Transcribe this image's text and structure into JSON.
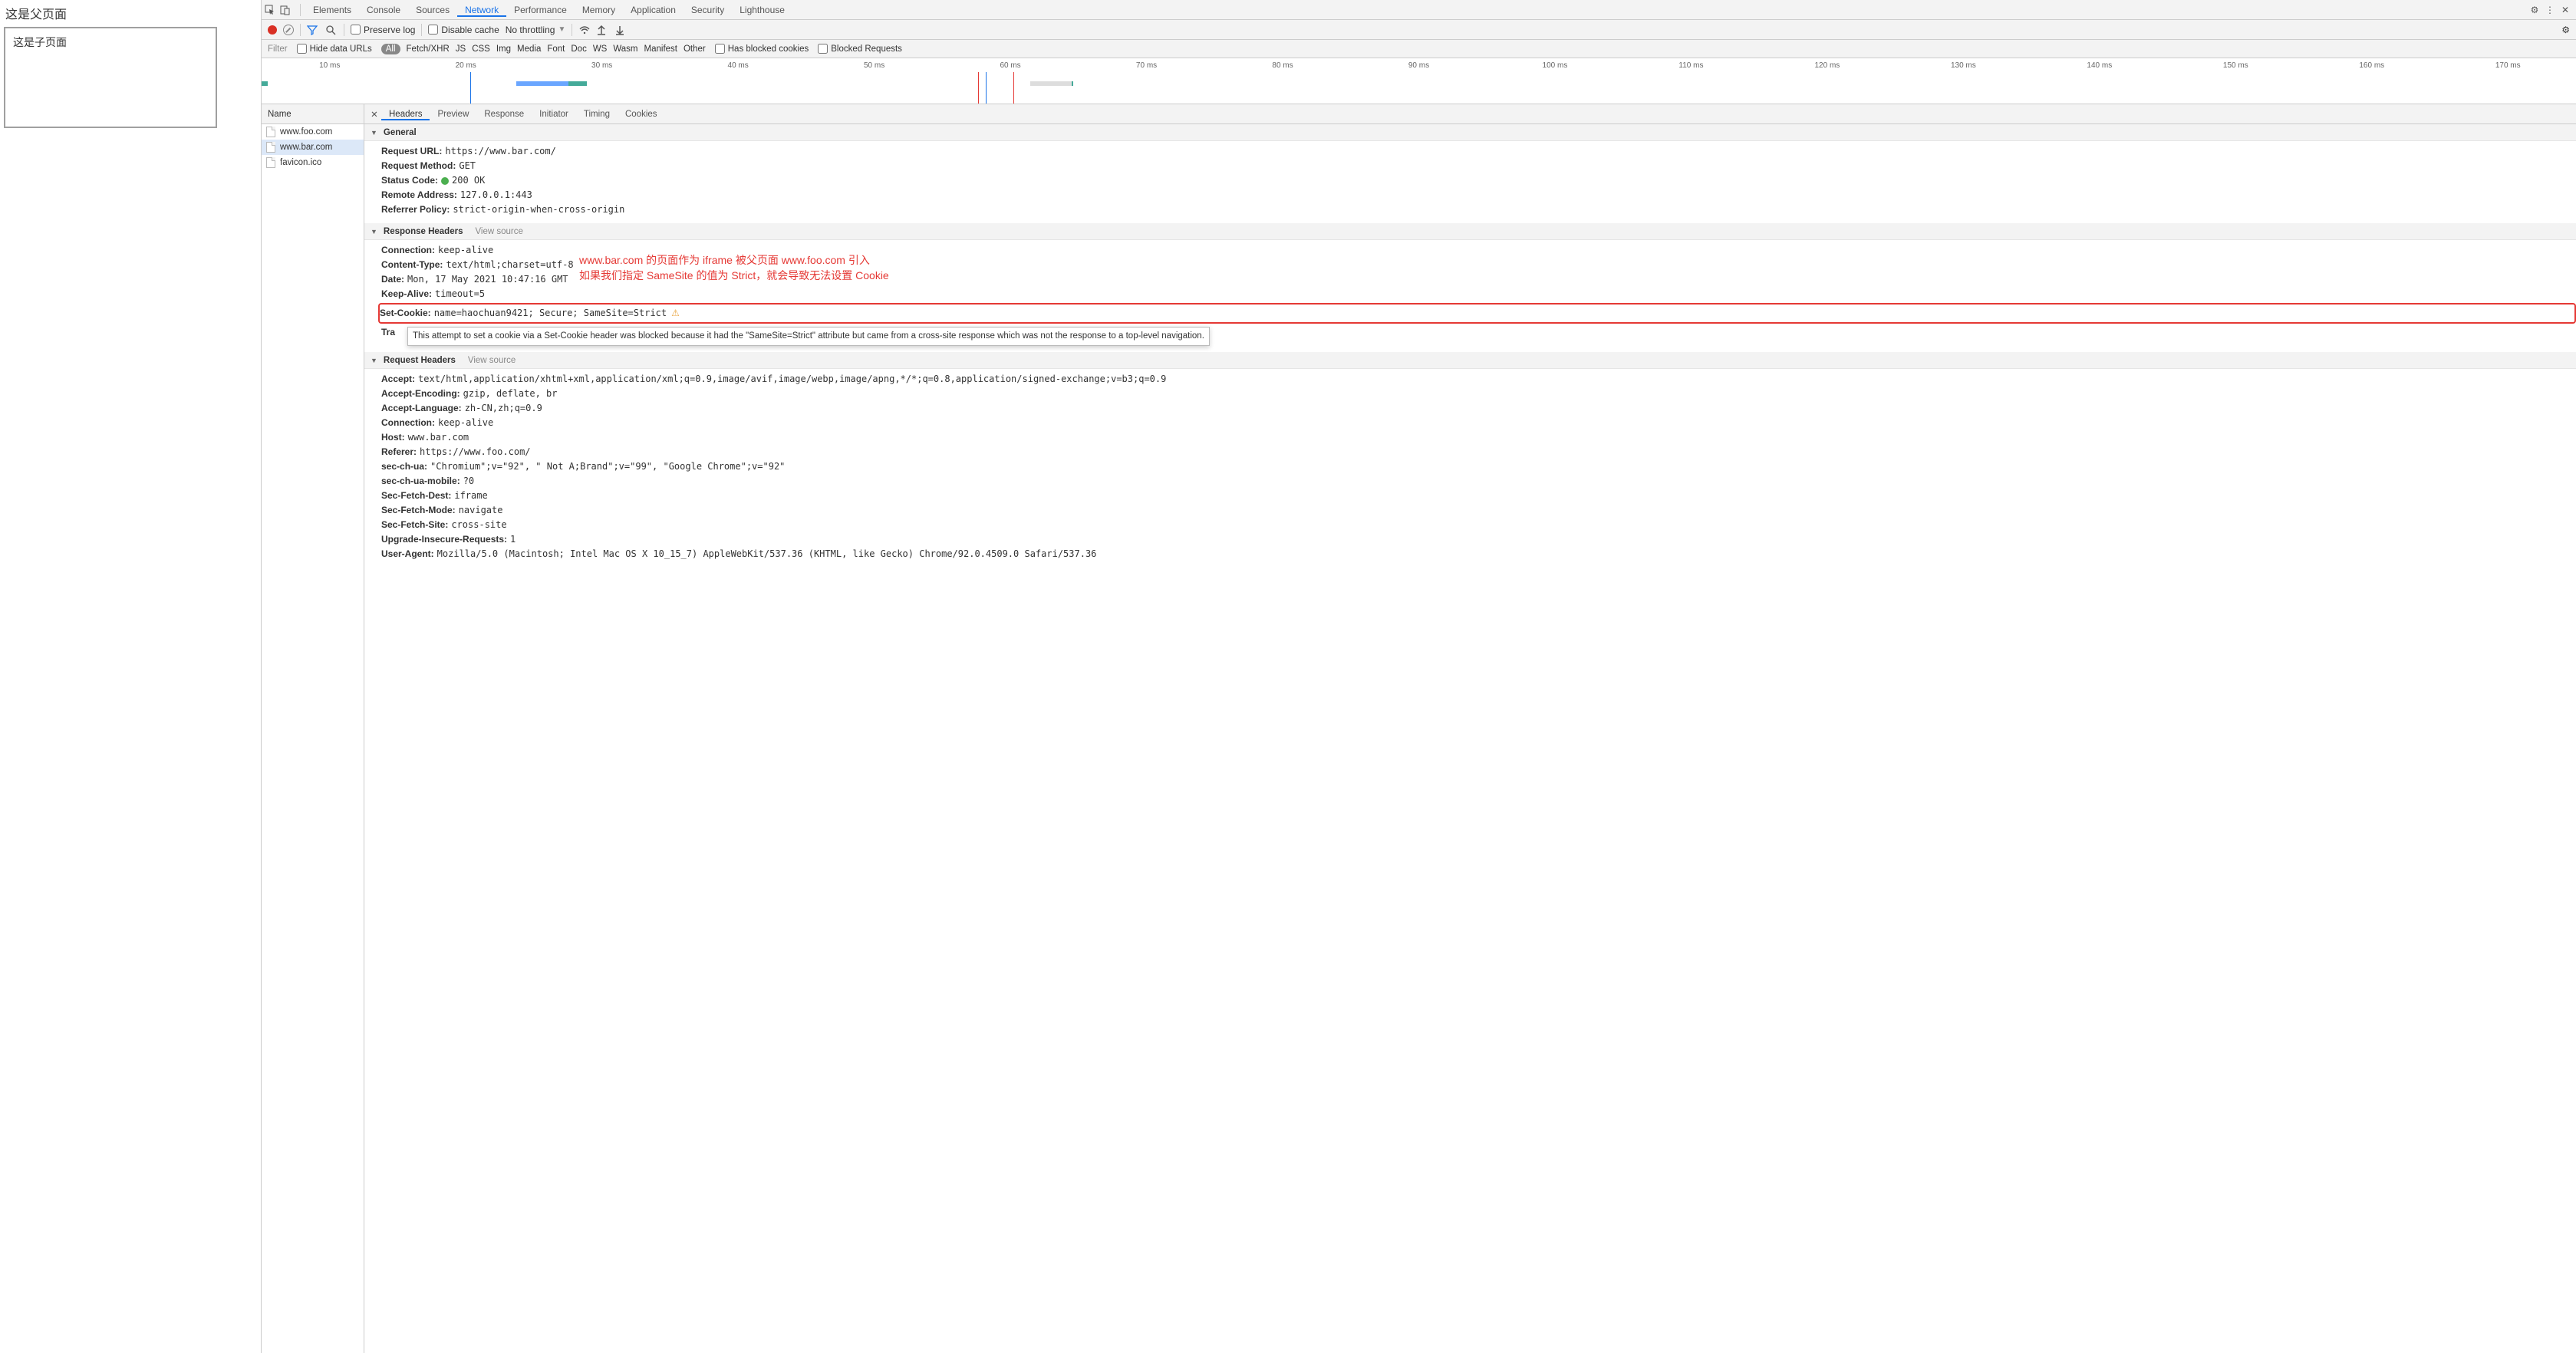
{
  "page": {
    "title": "这是父页面",
    "iframe_text": "这是子页面"
  },
  "devtools": {
    "tabs": [
      "Elements",
      "Console",
      "Sources",
      "Network",
      "Performance",
      "Memory",
      "Application",
      "Security",
      "Lighthouse"
    ],
    "active_tab": "Network",
    "toolbar": {
      "preserve_log": "Preserve log",
      "disable_cache": "Disable cache",
      "throttling": "No throttling"
    },
    "filterbar": {
      "filter_placeholder": "Filter",
      "hide_data_urls": "Hide data URLs",
      "type_filters": [
        "All",
        "Fetch/XHR",
        "JS",
        "CSS",
        "Img",
        "Media",
        "Font",
        "Doc",
        "WS",
        "Wasm",
        "Manifest",
        "Other"
      ],
      "has_blocked_cookies": "Has blocked cookies",
      "blocked_requests": "Blocked Requests"
    },
    "timeline_ticks": [
      "10 ms",
      "20 ms",
      "30 ms",
      "40 ms",
      "50 ms",
      "60 ms",
      "70 ms",
      "80 ms",
      "90 ms",
      "100 ms",
      "110 ms",
      "120 ms",
      "130 ms",
      "140 ms",
      "150 ms",
      "160 ms",
      "170 ms"
    ]
  },
  "requests": {
    "header": "Name",
    "rows": [
      "www.foo.com",
      "www.bar.com",
      "favicon.ico"
    ],
    "selected_index": 1
  },
  "details": {
    "tabs": [
      "Headers",
      "Preview",
      "Response",
      "Initiator",
      "Timing",
      "Cookies"
    ],
    "active": "Headers",
    "general": {
      "title": "General",
      "items": [
        {
          "k": "Request URL:",
          "v": "https://www.bar.com/"
        },
        {
          "k": "Request Method:",
          "v": "GET"
        },
        {
          "k": "Status Code:",
          "v": "200 OK",
          "status": true
        },
        {
          "k": "Remote Address:",
          "v": "127.0.0.1:443"
        },
        {
          "k": "Referrer Policy:",
          "v": "strict-origin-when-cross-origin"
        }
      ]
    },
    "response_headers": {
      "title": "Response Headers",
      "view_source": "View source",
      "items": [
        {
          "k": "Connection:",
          "v": "keep-alive"
        },
        {
          "k": "Content-Type:",
          "v": "text/html;charset=utf-8"
        },
        {
          "k": "Date:",
          "v": "Mon, 17 May 2021 10:47:16 GMT"
        },
        {
          "k": "Keep-Alive:",
          "v": "timeout=5"
        },
        {
          "k": "Set-Cookie:",
          "v": "name=haochuan9421; Secure; SameSite=Strict",
          "warn": true,
          "boxed": true
        },
        {
          "k": "Tra",
          "v": "",
          "tooltip": "This attempt to set a cookie via a Set-Cookie header was blocked because it had the \"SameSite=Strict\" attribute but came from a cross-site response which was not the response to a top-level navigation."
        }
      ]
    },
    "request_headers": {
      "title": "Request Headers",
      "view_source": "View source",
      "items": [
        {
          "k": "Accept:",
          "v": "text/html,application/xhtml+xml,application/xml;q=0.9,image/avif,image/webp,image/apng,*/*;q=0.8,application/signed-exchange;v=b3;q=0.9"
        },
        {
          "k": "Accept-Encoding:",
          "v": "gzip, deflate, br"
        },
        {
          "k": "Accept-Language:",
          "v": "zh-CN,zh;q=0.9"
        },
        {
          "k": "Connection:",
          "v": "keep-alive"
        },
        {
          "k": "Host:",
          "v": "www.bar.com"
        },
        {
          "k": "Referer:",
          "v": "https://www.foo.com/"
        },
        {
          "k": "sec-ch-ua:",
          "v": "\"Chromium\";v=\"92\", \" Not A;Brand\";v=\"99\", \"Google Chrome\";v=\"92\""
        },
        {
          "k": "sec-ch-ua-mobile:",
          "v": "?0"
        },
        {
          "k": "Sec-Fetch-Dest:",
          "v": "iframe"
        },
        {
          "k": "Sec-Fetch-Mode:",
          "v": "navigate"
        },
        {
          "k": "Sec-Fetch-Site:",
          "v": "cross-site"
        },
        {
          "k": "Upgrade-Insecure-Requests:",
          "v": "1"
        },
        {
          "k": "User-Agent:",
          "v": "Mozilla/5.0 (Macintosh; Intel Mac OS X 10_15_7) AppleWebKit/537.36 (KHTML, like Gecko) Chrome/92.0.4509.0 Safari/537.36"
        }
      ]
    }
  },
  "annotation": {
    "line1": "www.bar.com 的页面作为 iframe 被父页面 www.foo.com 引入",
    "line2": "如果我们指定 SameSite 的值为 Strict，就会导致无法设置 Cookie"
  }
}
